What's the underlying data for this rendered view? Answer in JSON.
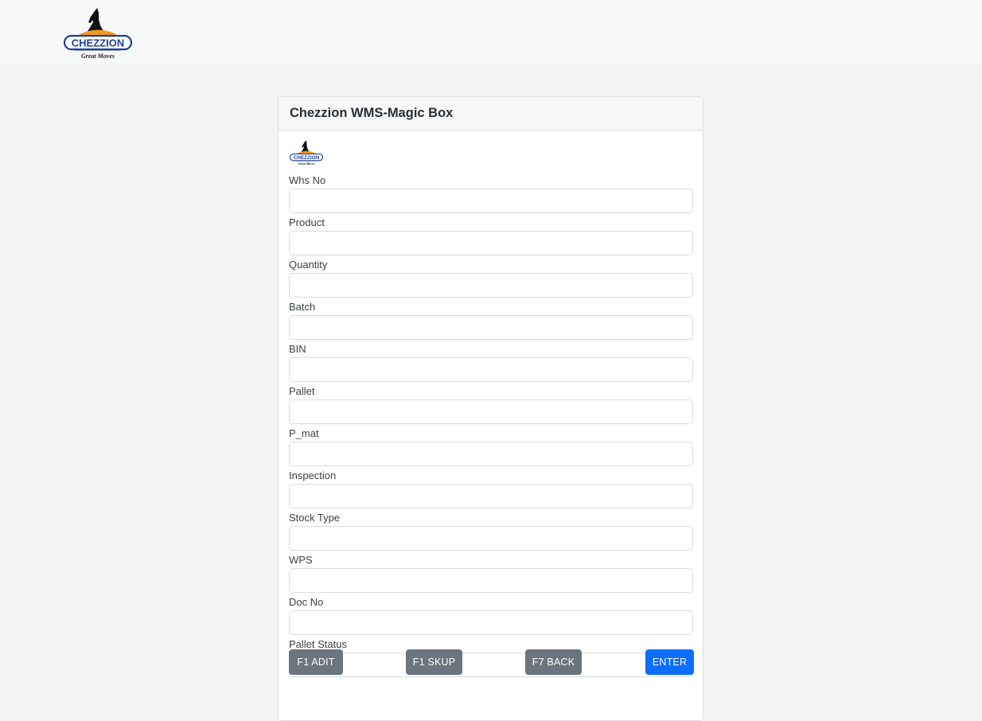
{
  "brand": {
    "name": "CHEZZION",
    "tagline": "Great Moves"
  },
  "card": {
    "title": "Chezzion WMS-Magic Box"
  },
  "fields": [
    {
      "label": "Whs No",
      "value": "",
      "placeholder": ""
    },
    {
      "label": "Product",
      "value": "",
      "placeholder": ""
    },
    {
      "label": "Quantity",
      "value": "",
      "placeholder": ""
    },
    {
      "label": "Batch",
      "value": "",
      "placeholder": ""
    },
    {
      "label": "BIN",
      "value": "",
      "placeholder": ""
    },
    {
      "label": "Pallet",
      "value": "",
      "placeholder": ""
    },
    {
      "label": "P_mat",
      "value": "",
      "placeholder": ""
    },
    {
      "label": "Inspection",
      "value": "",
      "placeholder": ""
    },
    {
      "label": "Stock Type",
      "value": "",
      "placeholder": ""
    },
    {
      "label": "WPS",
      "value": "",
      "placeholder": ""
    },
    {
      "label": "Doc No",
      "value": "",
      "placeholder": ""
    },
    {
      "label": "Pallet Status",
      "value": "",
      "placeholder": ""
    }
  ],
  "buttons": {
    "f1_adit": "F1 ADIT",
    "f1_skup": "F1 SKUP",
    "f7_back": "F7 BACK",
    "enter": "ENTER"
  },
  "colors": {
    "button_secondary": "#6c757d",
    "button_primary": "#0d6efd",
    "logo_blue": "#1f3f94",
    "logo_orange": "#f39a1e"
  }
}
